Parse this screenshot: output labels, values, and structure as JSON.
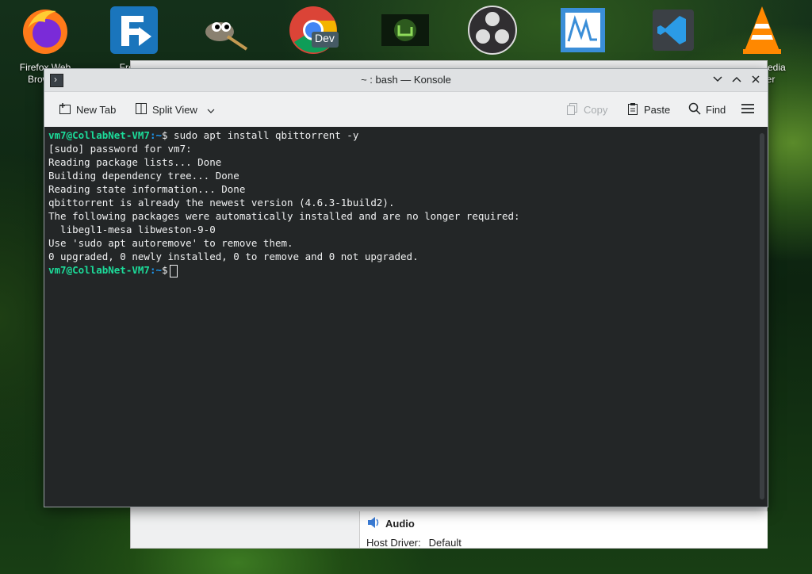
{
  "desktop": {
    "icons": [
      {
        "name": "firefox-icon",
        "label": "Firefox Web Browser"
      },
      {
        "name": "freefilesync-icon",
        "label": "Free D"
      },
      {
        "name": "gimp-icon",
        "label": ""
      },
      {
        "name": "chrome-dev-icon",
        "label": "",
        "badge": "Dev"
      },
      {
        "name": "linux-mint-icon",
        "label": ""
      },
      {
        "name": "obs-icon",
        "label": ""
      },
      {
        "name": "wavemeter-icon",
        "label": ""
      },
      {
        "name": "vscode-icon",
        "label": ""
      },
      {
        "name": "vlc-icon",
        "label": "VLC media player"
      }
    ]
  },
  "background_window": {
    "section_title": "Audio",
    "host_driver_label": "Host Driver:",
    "host_driver_value": "Default"
  },
  "konsole": {
    "title": "~ : bash — Konsole",
    "toolbar": {
      "new_tab": "New Tab",
      "split_view": "Split View",
      "copy": "Copy",
      "paste": "Paste",
      "find": "Find"
    },
    "terminal": {
      "prompt_user": "vm7@CollabNet-VM7",
      "prompt_path": ":~",
      "prompt_symbol": "$",
      "command": " sudo apt install qbittorrent -y",
      "output": [
        "[sudo] password for vm7:",
        "Reading package lists... Done",
        "Building dependency tree... Done",
        "Reading state information... Done",
        "qbittorrent is already the newest version (4.6.3-1build2).",
        "The following packages were automatically installed and are no longer required:",
        "  libegl1-mesa libweston-9-0",
        "Use 'sudo apt autoremove' to remove them.",
        "0 upgraded, 0 newly installed, 0 to remove and 0 not upgraded."
      ]
    }
  }
}
